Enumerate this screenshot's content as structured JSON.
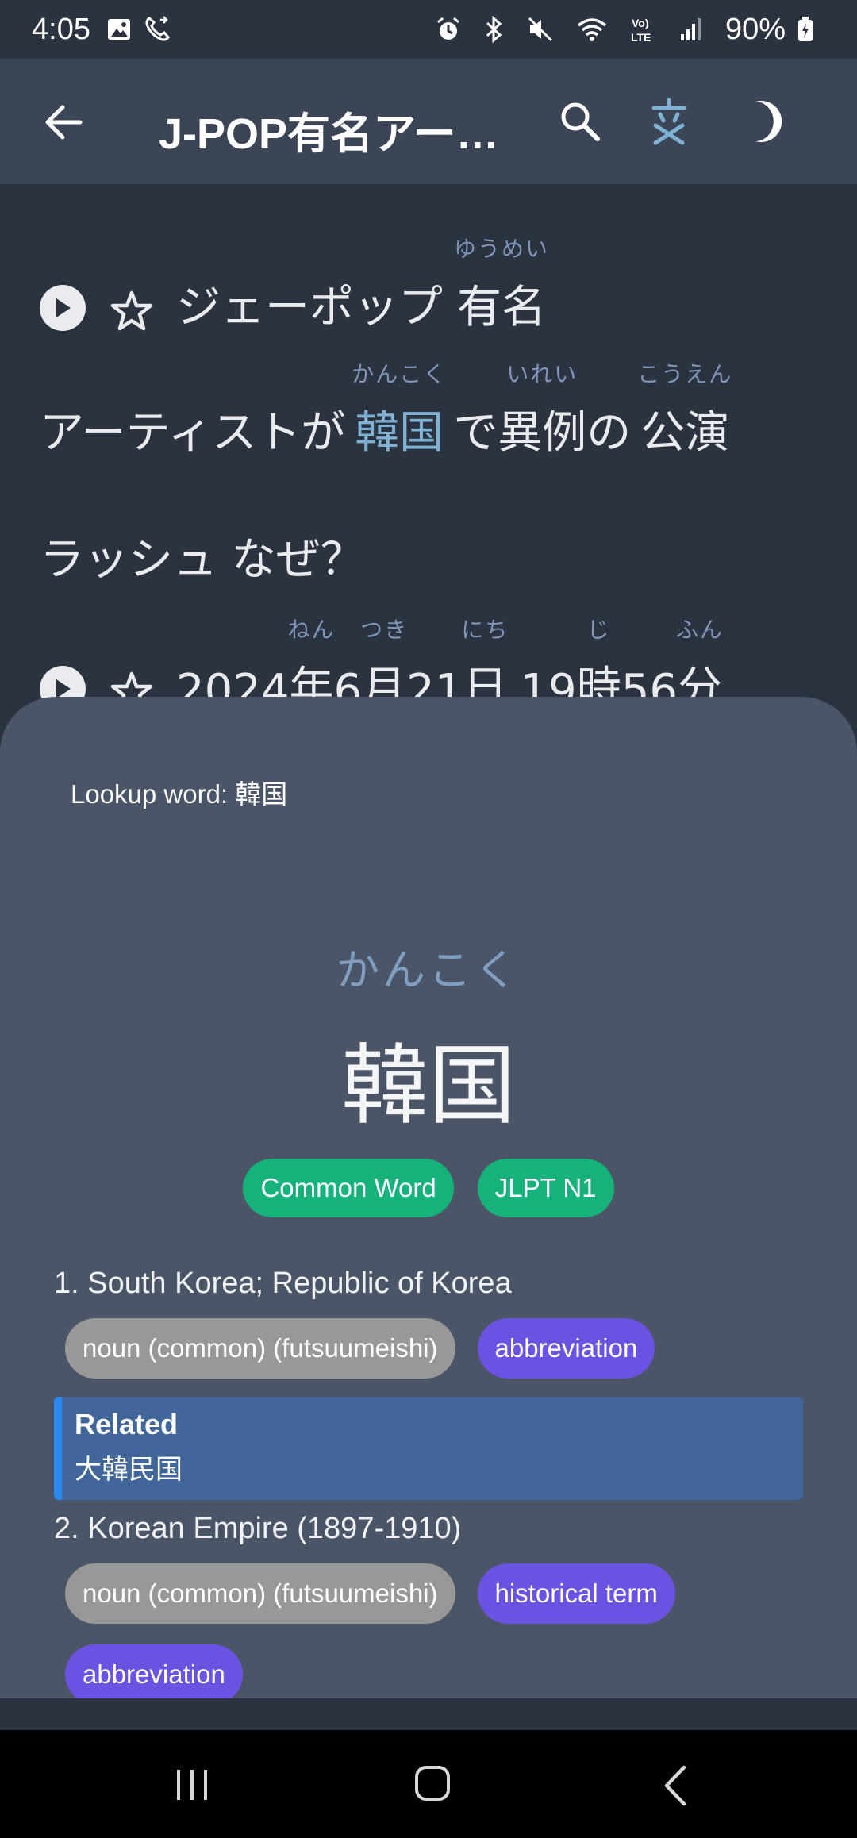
{
  "status_bar": {
    "time": "4:05",
    "battery": "90%",
    "icons": [
      "gallery-icon",
      "call-forward-icon",
      "alarm-icon",
      "bluetooth-icon",
      "mute-icon",
      "wifi-icon",
      "volte-icon",
      "signal-icon",
      "battery-icon"
    ]
  },
  "app_bar": {
    "title": "J-POP有名アー…",
    "icons": [
      "back-arrow-icon",
      "search-icon",
      "furigana-icon",
      "dark-mode-icon"
    ]
  },
  "article": {
    "line1": {
      "text_plain": "ジェーポップ",
      "w1": {
        "text": "有名",
        "ruby": "ゆうめい"
      }
    },
    "line2": {
      "t1": "アーティストが",
      "w1": {
        "text": "韓国",
        "ruby": "かんこく"
      },
      "t2": "で",
      "w2": {
        "text": "異例",
        "ruby": "いれい"
      },
      "t3": "の",
      "w3": {
        "text": "公演",
        "ruby": "こうえん"
      }
    },
    "line3": {
      "text": "ラッシュ なぜ？"
    },
    "line4": {
      "t1": "2024",
      "w1": {
        "text": "年",
        "ruby": "ねん"
      },
      "t2": "6",
      "w2": {
        "text": "月",
        "ruby": "つき"
      },
      "t3": "21",
      "w3": {
        "text": "日",
        "ruby": "にち"
      },
      "t4": "19",
      "w4": {
        "text": "時",
        "ruby": "じ"
      },
      "t5": "56",
      "w5": {
        "text": "分",
        "ruby": "ふん"
      }
    },
    "highlight_color": "#7fb2d2"
  },
  "sheet": {
    "lookup_label": "Lookup word: 韓国",
    "reading": "かんこく",
    "headword": "韓国",
    "badges": [
      "Common Word",
      "JLPT N1"
    ],
    "senses": [
      {
        "gloss": "1. South Korea; Republic of Korea",
        "tags": [
          "noun (common) (futsuumeishi)",
          "abbreviation"
        ]
      },
      {
        "gloss": "2. Korean Empire (1897-1910)",
        "tags": [
          "noun (common) (futsuumeishi)",
          "historical term",
          "abbreviation"
        ]
      }
    ],
    "related": {
      "title": "Related",
      "word": "大韓民国"
    }
  },
  "colors": {
    "background": "#2b3340",
    "app_bar": "#3c4556",
    "sheet": "#4b5568",
    "green_badge": "#17b27a",
    "gray_tag": "#9a9799",
    "purple_tag": "#6c52e0",
    "related_bg": "#41669a",
    "related_accent": "#2a8af2"
  }
}
